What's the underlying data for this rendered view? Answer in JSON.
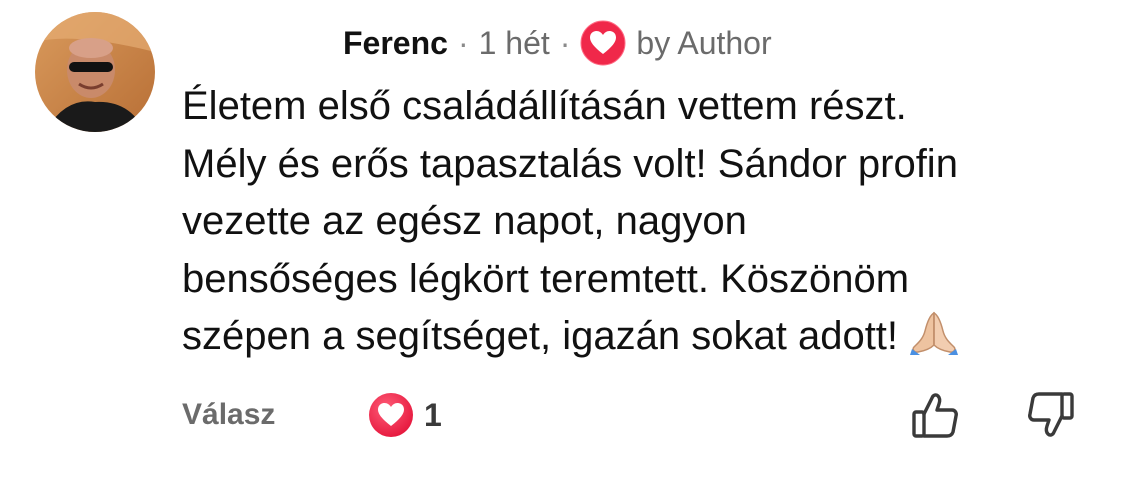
{
  "comment": {
    "author": "Ferenc",
    "separator": "·",
    "time": "1 hét",
    "author_badge_text": "by Author",
    "text_lines": [
      "Életem első családállításán vettem részt.",
      "Mély és erős tapasztalás volt! Sándor profin",
      "vezette az egész napot, nagyon",
      "bensőséges légkört teremtett. Köszönöm",
      "szépen a segítséget, igazán sokat adott!"
    ],
    "trailing_emoji": "folded-hands-emoji"
  },
  "actions": {
    "reply_label": "Válasz",
    "reaction_icon": "heart-icon",
    "reaction_count": "1",
    "like_icon": "thumbs-up-icon",
    "dislike_icon": "thumbs-down-icon"
  },
  "colors": {
    "heart_red": "#f0284a",
    "meta_gray": "#6b6b6b",
    "text": "#111111"
  }
}
